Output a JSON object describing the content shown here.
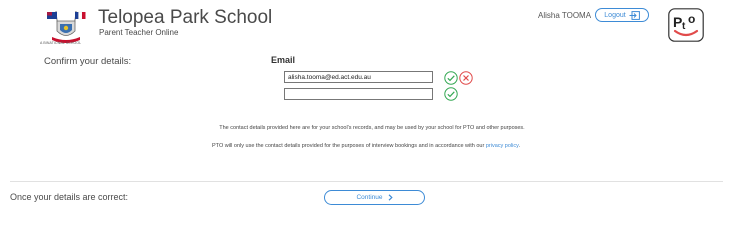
{
  "header": {
    "school_name": "Telopea Park School",
    "subtitle": "Parent Teacher Online",
    "logo_caption": "A BINATIONAL SCHOOL",
    "user_name": "Alisha TOOMA",
    "logout_label": "Logout",
    "brand_logo_text": "PtO"
  },
  "form": {
    "confirm_label": "Confirm your details:",
    "email_heading": "Email",
    "emails": [
      {
        "value": "alisha.tooma@ed.act.edu.au",
        "placeholder": ""
      },
      {
        "value": "",
        "placeholder": ""
      }
    ]
  },
  "notice": {
    "line1": "The contact details provided here are for your school's records, and may be used by your school for PTO and other purposes.",
    "line2_prefix": "PTO will only use the contact details provided for the purposes of interview bookings and in accordance with our ",
    "privacy_link": "privacy policy",
    "line2_suffix": "."
  },
  "footer": {
    "details_correct_label": "Once your details are correct:",
    "continue_label": "Continue"
  },
  "colors": {
    "accent": "#3d8bd6",
    "confirm_green": "#34a853",
    "remove_red": "#e14b4b",
    "text": "#4a4a4a"
  }
}
